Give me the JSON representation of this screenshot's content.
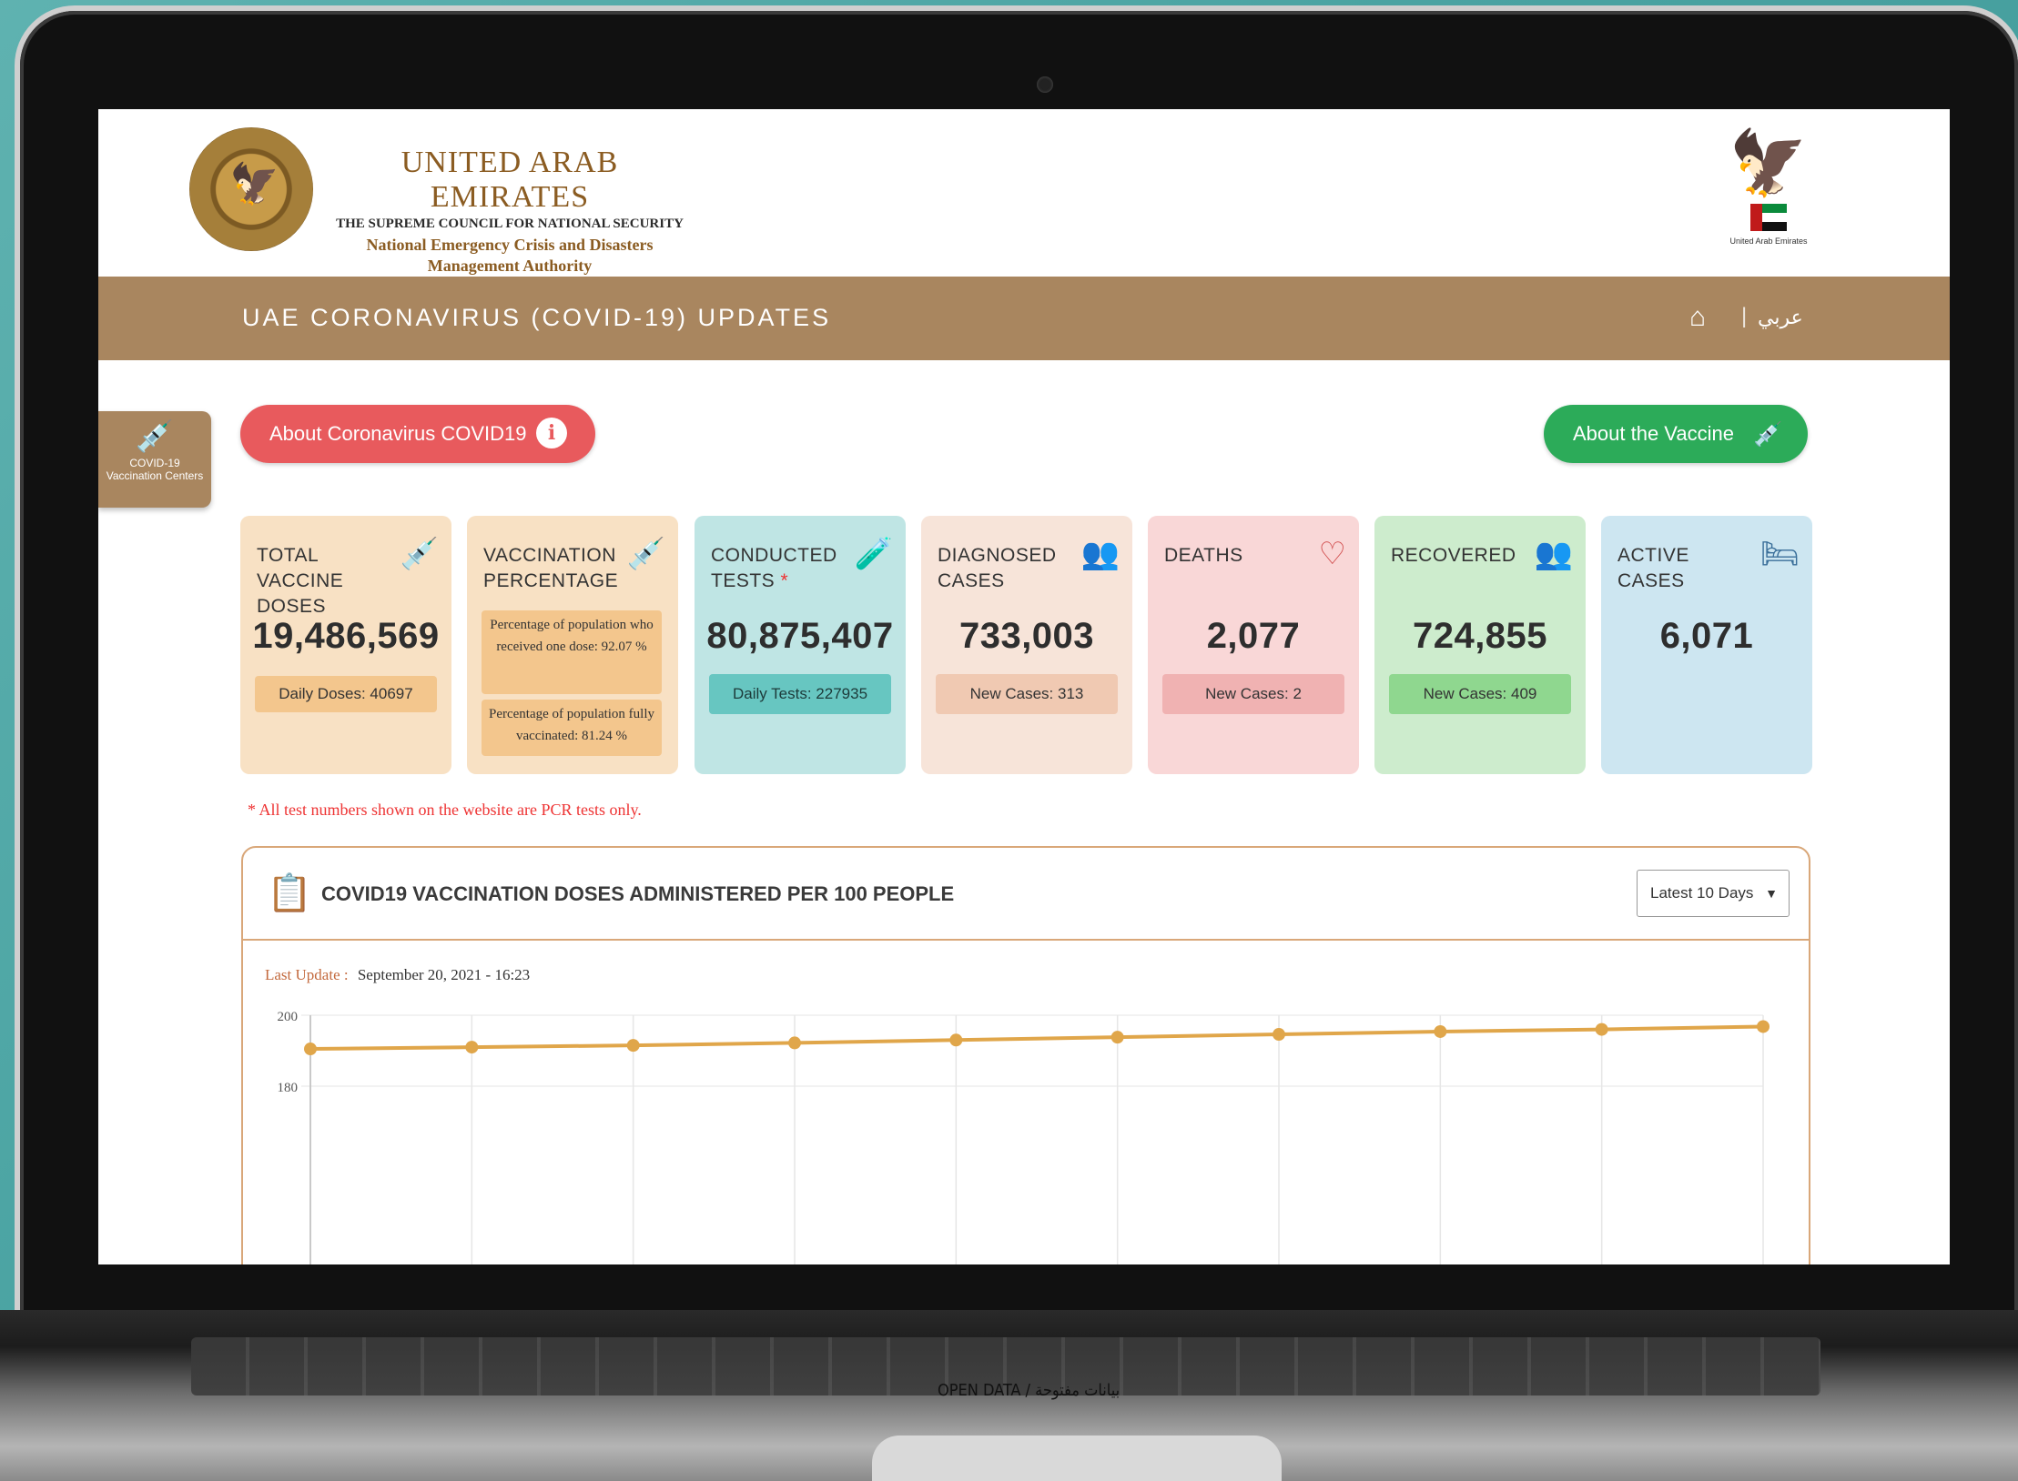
{
  "header": {
    "org_title": "UNITED ARAB EMIRATES",
    "org_line2": "THE SUPREME COUNCIL FOR NATIONAL SECURITY",
    "org_line3": "National Emergency Crisis and Disasters",
    "org_line4": "Management Authority",
    "right_emblem_caption": "United Arab Emirates"
  },
  "nav": {
    "title": "UAE CORONAVIRUS (COVID-19) UPDATES",
    "home_icon": "home-icon",
    "language": "عربي"
  },
  "side_tab": {
    "line1": "COVID-19",
    "line2": "Vaccination Centers",
    "icon": "vaccine-shield-icon"
  },
  "buttons": {
    "about_covid": "About Coronavirus COVID19",
    "about_vaccine": "About the Vaccine",
    "info_icon": "info-icon"
  },
  "cards": [
    {
      "label": "TOTAL VACCINE DOSES",
      "value": "19,486,569",
      "sub": "Daily Doses: 40697",
      "icon": "syringe-vial-icon",
      "color": "#f8e1c4"
    },
    {
      "label": "VACCINATION PERCENTAGE",
      "box1": "Percentage of population who received one dose: 92.07 %",
      "box2": "Percentage of population fully vaccinated: 81.24 %",
      "icon": "syringe-vial-icon",
      "color": "#f8e1c4"
    },
    {
      "label": "CONDUCTED TESTS",
      "asterisk": "*",
      "value": "80,875,407",
      "sub": "Daily Tests: 227935",
      "icon": "test-tubes-icon",
      "color": "#bfe5e4"
    },
    {
      "label": "DIAGNOSED CASES",
      "value": "733,003",
      "sub": "New Cases: 313",
      "icon": "people-group-icon",
      "color": "#f7e4d9"
    },
    {
      "label": "DEATHS",
      "value": "2,077",
      "sub": "New Cases: 2",
      "icon": "heartbeat-icon",
      "color": "#f9d7d7"
    },
    {
      "label": "RECOVERED",
      "value": "724,855",
      "sub": "New Cases: 409",
      "icon": "people-group-icon",
      "color": "#cdeccd"
    },
    {
      "label": "ACTIVE CASES",
      "value": "6,071",
      "icon": "hospital-bed-icon",
      "color": "#cde6f1"
    }
  ],
  "note": "* All test numbers shown on the website are PCR tests only.",
  "panel": {
    "title": "COVID19 VACCINATION DOSES ADMINISTERED PER 100 PEOPLE",
    "icon": "clipboard-vaccine-icon",
    "select_value": "Latest 10 Days",
    "last_update_label": "Last Update :",
    "last_update_value": "September 20, 2021 - 16:23"
  },
  "chart_data": {
    "type": "line",
    "y_ticks": [
      "200",
      "180"
    ],
    "ylim": [
      120,
      200
    ],
    "series": [
      {
        "values": [
          190.5,
          191.0,
          191.5,
          192.2,
          193.0,
          193.8,
          194.6,
          195.4,
          196.0,
          196.8
        ]
      }
    ],
    "line_color": "#e0a64a",
    "grid": true
  },
  "base_caption": "OPEN DATA / بيانات مفتوحة"
}
